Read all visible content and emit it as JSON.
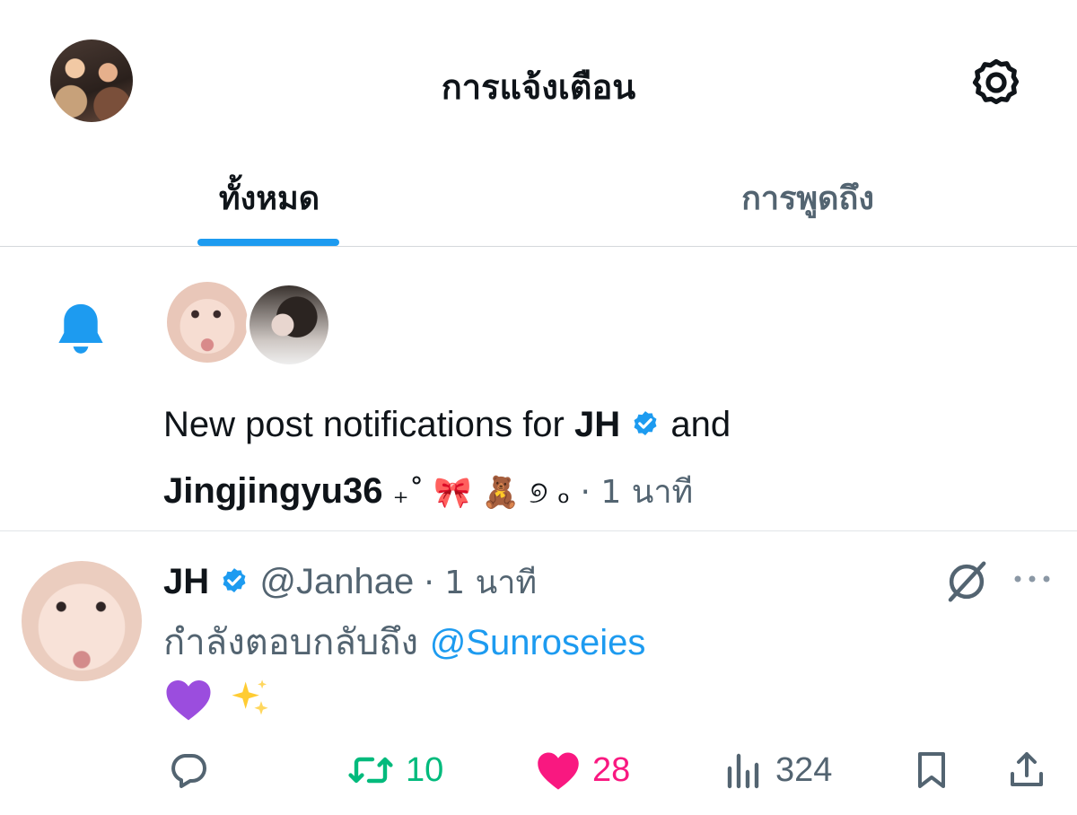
{
  "header": {
    "title": "การแจ้งเตือน",
    "avatar_icon": "profile-avatar",
    "settings_icon": "gear-icon"
  },
  "tabs": [
    {
      "label": "ทั้งหมด",
      "selected": true
    },
    {
      "label": "การพูดถึง",
      "selected": false
    }
  ],
  "notification": {
    "icon": "bell-icon",
    "prefix": "New post notifications for ",
    "user1": "JH",
    "connector": " and",
    "user2": "Jingjingyu36",
    "user2_suffix": "₊˚ 🎀 🧸 ୭ ₒ",
    "time": "· 1 นาที"
  },
  "post": {
    "name": "JH",
    "handle": "@Janhae",
    "time": "· 1 นาที",
    "reply_prefix": "กำลังตอบกลับถึง ",
    "reply_to": "@Sunroseies",
    "body_icons": [
      "purple-heart-emoji",
      "sparkles-emoji"
    ],
    "actions": {
      "reply_count": "",
      "repost_count": "10",
      "like_count": "28",
      "view_count": "324"
    }
  },
  "colors": {
    "accent": "#1d9bf0",
    "repost": "#00ba7c",
    "like": "#f91880",
    "muted": "#536471",
    "text": "#0f1419"
  }
}
